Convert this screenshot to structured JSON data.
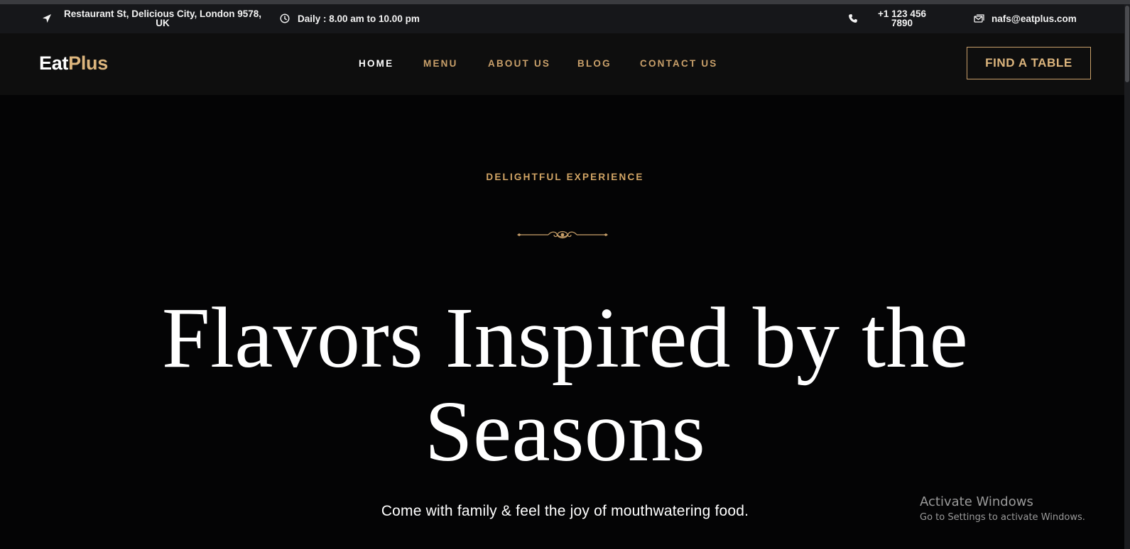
{
  "topbar": {
    "address": "Restaurant St, Delicious City, London 9578, UK",
    "hours": "Daily : 8.00 am to 10.00 pm",
    "phone": "+1 123 456 7890",
    "email": "nafs@eatplus.com",
    "icons": {
      "address": "location-arrow-icon",
      "hours": "clock-icon",
      "phone": "phone-icon",
      "email": "mail-icon"
    }
  },
  "nav": {
    "logo_part1": "Eat",
    "logo_part2": "Plus",
    "links": [
      {
        "label": "HOME",
        "active": true
      },
      {
        "label": "MENU",
        "active": false
      },
      {
        "label": "ABOUT US",
        "active": false
      },
      {
        "label": "BLOG",
        "active": false
      },
      {
        "label": "CONTACT US",
        "active": false
      }
    ],
    "cta": "FIND A TABLE"
  },
  "hero": {
    "eyebrow": "DELIGHTFUL EXPERIENCE",
    "headline": "Flavors Inspired by the Seasons",
    "subline": "Come with family & feel the joy of mouthwatering food."
  },
  "os_watermark": {
    "title": "Activate Windows",
    "subtitle": "Go to Settings to activate Windows."
  },
  "colors": {
    "accent": "#c9a06a",
    "logo_accent": "#dcb57d",
    "topbar_bg": "#16171a",
    "nav_bg": "#0e0e0e",
    "hero_bg": "#040405"
  }
}
